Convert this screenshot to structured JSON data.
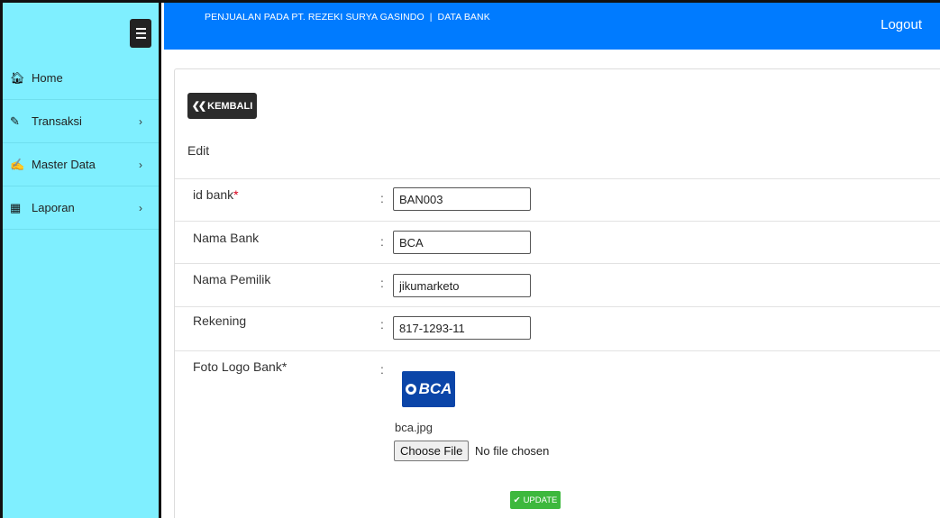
{
  "sidebar": {
    "toggle_icon": "hamburger-menu-icon",
    "items": [
      {
        "label": "Home",
        "icon": "home-icon",
        "has_submenu": false
      },
      {
        "label": "Transaksi",
        "icon": "pencil-icon",
        "has_submenu": true
      },
      {
        "label": "Master Data",
        "icon": "edit-icon",
        "has_submenu": true
      },
      {
        "label": "Laporan",
        "icon": "calendar-icon",
        "has_submenu": true
      }
    ],
    "background": "#7fefff"
  },
  "topbar": {
    "title": "PENJUALAN PADA PT. REZEKI SURYA GASINDO",
    "separator": "|",
    "section": "DATA BANK",
    "logout_label": "Logout",
    "background": "#007bff"
  },
  "content": {
    "back_button_label": "KEMBALI",
    "form_heading": "Edit",
    "fields": [
      {
        "label": "id bank",
        "required_mark": "*",
        "value": "BAN003"
      },
      {
        "label": "Nama Bank",
        "value": "BCA"
      },
      {
        "label": "Nama Pemilik",
        "value": "jikumarketo"
      },
      {
        "label": "Rekening",
        "value": "817-1293-11"
      }
    ],
    "logo_field": {
      "label": "Foto Logo Bank*",
      "logo_text": "BCA",
      "current_file": "bca.jpg",
      "choose_file_label": "Choose File",
      "no_file_label": "No file chosen"
    },
    "colon": ":",
    "update_button_label": "UPDATE",
    "update_color": "#3db83d"
  }
}
